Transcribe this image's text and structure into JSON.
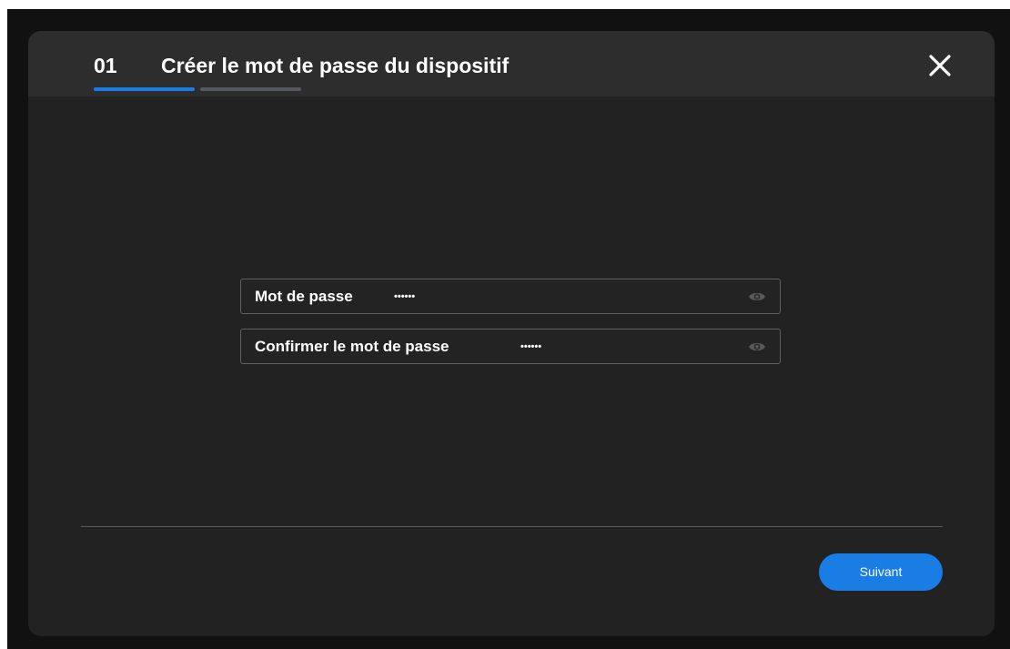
{
  "dialog": {
    "step_number": "01",
    "title": "Créer le mot de passe du dispositif",
    "progress": {
      "current_step": 1,
      "total_steps": 2
    },
    "colors": {
      "accent": "#1a7de5",
      "background": "#222222",
      "header": "#2d2d2d",
      "inactive_step": "#55585c"
    },
    "close_icon": "close-icon"
  },
  "form": {
    "password": {
      "label": "Mot de passe",
      "masked_value": "••••••",
      "toggle_icon": "eye-icon"
    },
    "confirm_password": {
      "label": "Confirmer le mot de passe",
      "masked_value": "••••••",
      "toggle_icon": "eye-icon"
    }
  },
  "footer": {
    "next_label": "Suivant"
  }
}
